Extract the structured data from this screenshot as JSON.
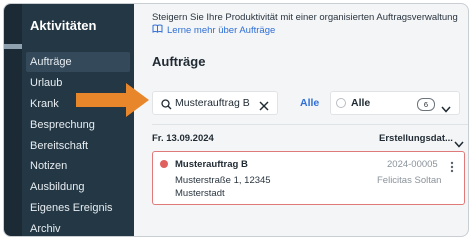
{
  "sidebar": {
    "title": "Aktivitäten",
    "items": [
      {
        "label": "Aufträge"
      },
      {
        "label": "Urlaub"
      },
      {
        "label": "Krank"
      },
      {
        "label": "Besprechung"
      },
      {
        "label": "Bereitschaft"
      },
      {
        "label": "Notizen"
      },
      {
        "label": "Ausbildung"
      },
      {
        "label": "Eigenes Ereignis"
      },
      {
        "label": "Archiv"
      }
    ]
  },
  "promo": {
    "text": "Steigern Sie Ihre Produktivität mit einer organisierten Auftragsverwaltung",
    "link_label": "Lerne mehr über Aufträge",
    "link_icon": "book-icon"
  },
  "main": {
    "title": "Aufträge",
    "search": {
      "value": "Musterauftrag B",
      "icon": "search-icon",
      "clear_icon": "close-icon"
    },
    "filter_link": "Alle",
    "filter_select": {
      "label": "Alle",
      "count": "6",
      "icon": "chevron-down-icon"
    },
    "group_date": "Fr. 13.09.2024",
    "sort_label": "Erstellungsdat...",
    "order": {
      "name": "Musterauftrag B",
      "number": "2024-00005",
      "street": "Musterstraße 1, 12345",
      "city": "Musterstadt",
      "employee": "Felicitas Soltan",
      "status_color": "#e0605f"
    }
  },
  "annotation": {
    "arrow_color": "#e8862b"
  },
  "colors": {
    "sidebar_bg": "#233744",
    "accent": "#2f6fd6"
  }
}
